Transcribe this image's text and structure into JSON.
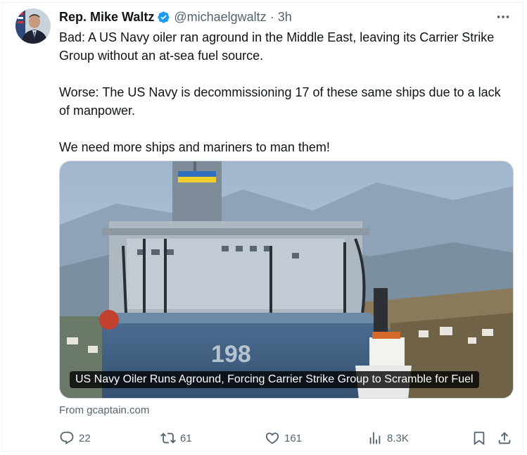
{
  "author": {
    "name": "Rep. Mike Waltz",
    "handle": "@michaelgwaltz",
    "separator": "·",
    "time": "3h",
    "verified_color": "#1d9bf0"
  },
  "tweet": {
    "paragraphs": [
      "Bad: A US Navy oiler ran aground in the Middle East, leaving its Carrier Strike Group without an at-sea fuel source.",
      "Worse: The US Navy is decommissioning 17 of these same ships due to a lack of manpower.",
      "We need more ships and mariners to man them!"
    ]
  },
  "card": {
    "caption": "US Navy Oiler Runs Aground, Forcing Carrier Strike Group to Scramble for Fuel",
    "source": "From gcaptain.com",
    "hull_number": "198"
  },
  "actions": {
    "replies": "22",
    "reposts": "61",
    "likes": "161",
    "views": "8.3K"
  },
  "colors": {
    "text": "#0f1419",
    "secondary": "#536471",
    "accent": "#1d9bf0"
  },
  "icons": [
    "more-icon",
    "verified-badge-icon",
    "reply-icon",
    "repost-icon",
    "like-icon",
    "views-icon",
    "bookmark-icon",
    "share-icon"
  ]
}
